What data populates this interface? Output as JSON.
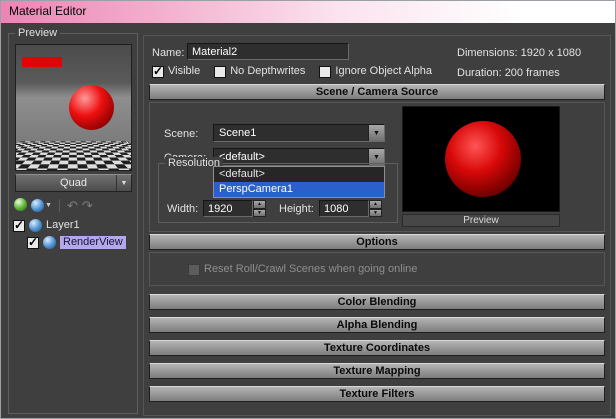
{
  "window": {
    "title": "Material Editor"
  },
  "glyphs": {
    "check": "✓",
    "up": "▲",
    "down": "▼",
    "undo_arrow": "↶",
    "redo_arrow": "↷"
  },
  "colors": {
    "selection_blue": "#2a5fcc",
    "tree_selection_purple": "#b4a8ea",
    "title_pink": "#ec84b5",
    "sphere_red": "#d80808"
  },
  "preview_panel": {
    "label": "Preview",
    "quad_label": "Quad",
    "tree": [
      {
        "label": "Layer1",
        "checked": true,
        "selected": false
      },
      {
        "label": "RenderView",
        "checked": true,
        "selected": true
      }
    ]
  },
  "material_header": {
    "name_label": "Name:",
    "name_value": "Material2",
    "dimensions": "Dimensions: 1920 x 1080",
    "visible_label": "Visible",
    "visible_checked": true,
    "no_depthwrites_label": "No Depthwrites",
    "no_depthwrites_checked": false,
    "ignore_object_alpha_label": "Ignore Object Alpha",
    "ignore_object_alpha_checked": false,
    "duration": "Duration: 200 frames"
  },
  "scene_section": {
    "title": "Scene / Camera Source",
    "scene_label": "Scene:",
    "scene_value": "Scene1",
    "camera_label": "Camera:",
    "camera_value": "<default>",
    "camera_options": [
      {
        "label": "<default>",
        "selected": false
      },
      {
        "label": "PerspCamera1",
        "selected": true
      }
    ],
    "resolution": {
      "label": "Resolution",
      "width_label": "Width:",
      "width_value": "1920",
      "height_label": "Height:",
      "height_value": "1080"
    },
    "preview_caption": "Preview"
  },
  "options_section": {
    "title": "Options",
    "reset_label": "Reset Roll/Crawl Scenes when going online",
    "reset_checked": false,
    "reset_enabled": false
  },
  "collapsed_sections": [
    {
      "title": "Color Blending"
    },
    {
      "title": "Alpha Blending"
    },
    {
      "title": "Texture Coordinates"
    },
    {
      "title": "Texture Mapping"
    },
    {
      "title": "Texture Filters"
    }
  ]
}
